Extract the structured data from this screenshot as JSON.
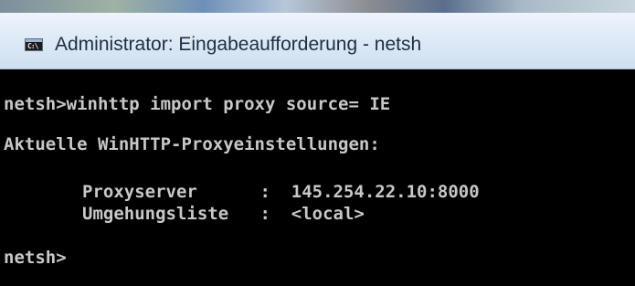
{
  "window": {
    "title": "Administrator: Eingabeaufforderung - netsh",
    "icon": "console-icon",
    "icon_glyph": "C:\\"
  },
  "console": {
    "lines": [
      "netsh>winhttp import proxy source= IE",
      "Aktuelle WinHTTP-Proxyeinstellungen:",
      "Proxyserver      :  145.254.22.10:8000",
      "Umgehungsliste   :  <local>",
      "netsh>"
    ],
    "text_color": "#c8c8c8",
    "background": "#000000"
  }
}
